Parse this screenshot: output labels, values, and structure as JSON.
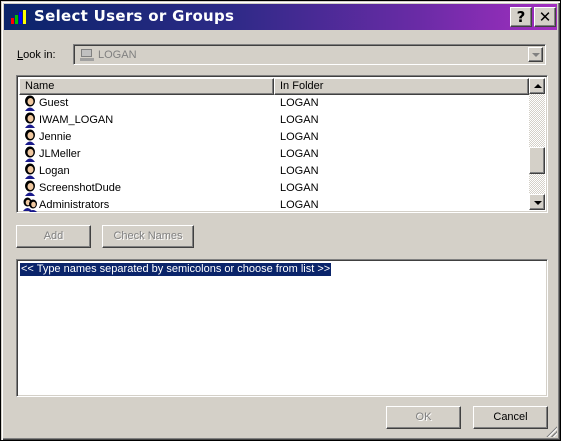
{
  "window": {
    "title": "Select Users or Groups"
  },
  "title_buttons": {
    "help": "?",
    "close": "✕"
  },
  "look_in": {
    "label": "Look in:",
    "value": "LOGAN",
    "icon": "computer-icon"
  },
  "list": {
    "columns": [
      "Name",
      "In Folder"
    ],
    "rows": [
      {
        "name": "Guest",
        "folder": "LOGAN",
        "icon": "user-icon"
      },
      {
        "name": "IWAM_LOGAN",
        "folder": "LOGAN",
        "icon": "user-icon"
      },
      {
        "name": "Jennie",
        "folder": "LOGAN",
        "icon": "user-icon"
      },
      {
        "name": "JLMeller",
        "folder": "LOGAN",
        "icon": "user-icon"
      },
      {
        "name": "Logan",
        "folder": "LOGAN",
        "icon": "user-icon"
      },
      {
        "name": "ScreenshotDude",
        "folder": "LOGAN",
        "icon": "user-icon"
      },
      {
        "name": "Administrators",
        "folder": "LOGAN",
        "icon": "group-icon"
      }
    ]
  },
  "buttons": {
    "add": "Add",
    "check_names": "Check Names",
    "ok": "OK",
    "cancel": "Cancel"
  },
  "names_box": {
    "text": "<< Type names separated by semicolons or choose from list >>"
  }
}
